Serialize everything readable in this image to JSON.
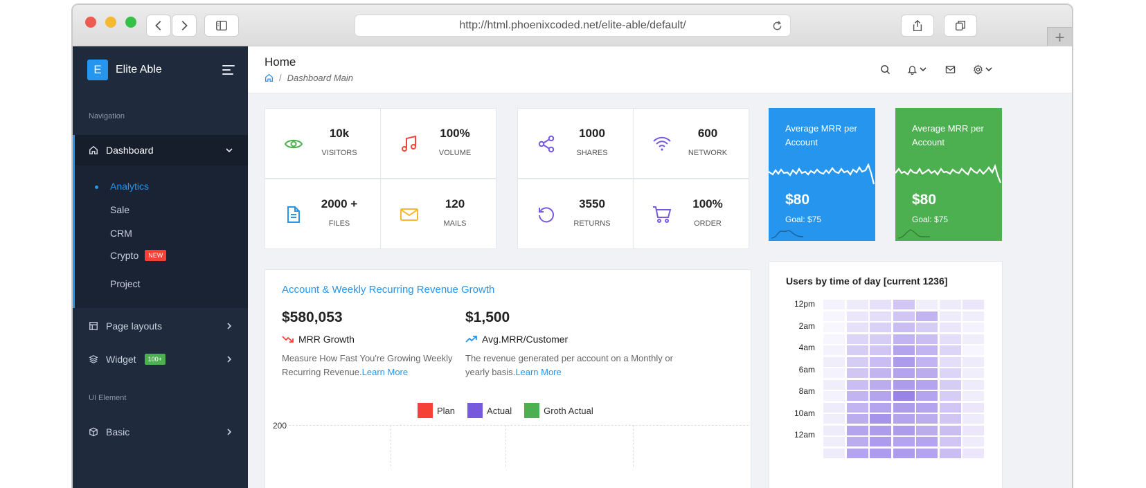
{
  "browser": {
    "url": "http://html.phoenixcoded.net/elite-able/default/",
    "plus_tab": "+"
  },
  "sidebar": {
    "brand_letter": "E",
    "brand_name": "Elite Able",
    "caption_navigation": "Navigation",
    "dashboard_label": "Dashboard",
    "sub_items": [
      {
        "label": "Analytics",
        "active": true
      },
      {
        "label": "Sale"
      },
      {
        "label": "CRM"
      },
      {
        "label": "Crypto",
        "badge": "NEW"
      },
      {
        "label": "Project"
      }
    ],
    "page_layouts_label": "Page layouts",
    "widget_label": "Widget",
    "widget_badge": "100+",
    "caption_ui": "UI Element",
    "basic_label": "Basic"
  },
  "header": {
    "title": "Home",
    "breadcrumb_sep": "/",
    "breadcrumb": "Dashboard Main"
  },
  "stats": [
    {
      "value": "10k",
      "label": "VISITORS",
      "icon": "eye-icon",
      "color": "#4caf50"
    },
    {
      "value": "100%",
      "label": "VOLUME",
      "icon": "music-icon",
      "color": "#f44236"
    },
    {
      "value": "1000",
      "label": "SHARES",
      "icon": "share-icon",
      "color": "#7759de"
    },
    {
      "value": "600",
      "label": "NETWORK",
      "icon": "wifi-icon",
      "color": "#7759de"
    },
    {
      "value": "2000 +",
      "label": "FILES",
      "icon": "file-icon",
      "color": "#2595ee"
    },
    {
      "value": "120",
      "label": "MAILS",
      "icon": "mail-icon",
      "color": "#f5b833"
    },
    {
      "value": "3550",
      "label": "RETURNS",
      "icon": "rotate-icon",
      "color": "#7759de"
    },
    {
      "value": "100%",
      "label": "ORDER",
      "icon": "cart-icon",
      "color": "#7759de"
    }
  ],
  "mrr_cards": [
    {
      "title": "Average MRR per Account",
      "value": "$80",
      "goal": "Goal: $75",
      "color": "#2595ee"
    },
    {
      "title": "Average MRR per Account",
      "value": "$80",
      "goal": "Goal: $75",
      "color": "#4caf50"
    }
  ],
  "revenue": {
    "title": "Account & Weekly Recurring Revenue Growth",
    "left_value": "$580,053",
    "left_sub": "MRR Growth",
    "left_desc": "Measure How Fast You're Growing Weekly Recurring Revenue.",
    "left_link": "Learn More",
    "right_value": "$1,500",
    "right_sub": "Avg.MRR/Customer",
    "right_desc": "The revenue generated per account on a Monthly or yearly basis.",
    "right_link": "Learn More",
    "legend": [
      {
        "name": "Plan",
        "color": "#f44236"
      },
      {
        "name": "Actual",
        "color": "#7759de"
      },
      {
        "name": "Groth Actual",
        "color": "#4caf50"
      }
    ],
    "y_tick": "200"
  },
  "heatmap": {
    "title": "Users by time of day [current 1236]",
    "row_labels": [
      "12pm",
      "2am",
      "4am",
      "6am",
      "8am",
      "10am",
      "12am"
    ],
    "intensity": [
      [
        0.08,
        0.12,
        0.18,
        0.35,
        0.1,
        0.12,
        0.15
      ],
      [
        0.06,
        0.15,
        0.2,
        0.35,
        0.45,
        0.12,
        0.1
      ],
      [
        0.05,
        0.18,
        0.28,
        0.4,
        0.3,
        0.15,
        0.08
      ],
      [
        0.06,
        0.25,
        0.3,
        0.45,
        0.4,
        0.2,
        0.1
      ],
      [
        0.08,
        0.3,
        0.35,
        0.55,
        0.45,
        0.25,
        0.06
      ],
      [
        0.1,
        0.3,
        0.4,
        0.6,
        0.45,
        0.2,
        0.12
      ],
      [
        0.08,
        0.35,
        0.45,
        0.55,
        0.5,
        0.25,
        0.1
      ],
      [
        0.1,
        0.4,
        0.5,
        0.6,
        0.55,
        0.3,
        0.12
      ],
      [
        0.08,
        0.45,
        0.55,
        0.75,
        0.55,
        0.3,
        0.1
      ],
      [
        0.12,
        0.45,
        0.55,
        0.6,
        0.55,
        0.35,
        0.15
      ],
      [
        0.1,
        0.5,
        0.65,
        0.55,
        0.5,
        0.35,
        0.12
      ],
      [
        0.12,
        0.55,
        0.6,
        0.6,
        0.5,
        0.4,
        0.15
      ],
      [
        0.1,
        0.5,
        0.6,
        0.55,
        0.55,
        0.35,
        0.12
      ],
      [
        0.12,
        0.55,
        0.6,
        0.6,
        0.55,
        0.4,
        0.15
      ]
    ],
    "base_color": "#7759de"
  }
}
